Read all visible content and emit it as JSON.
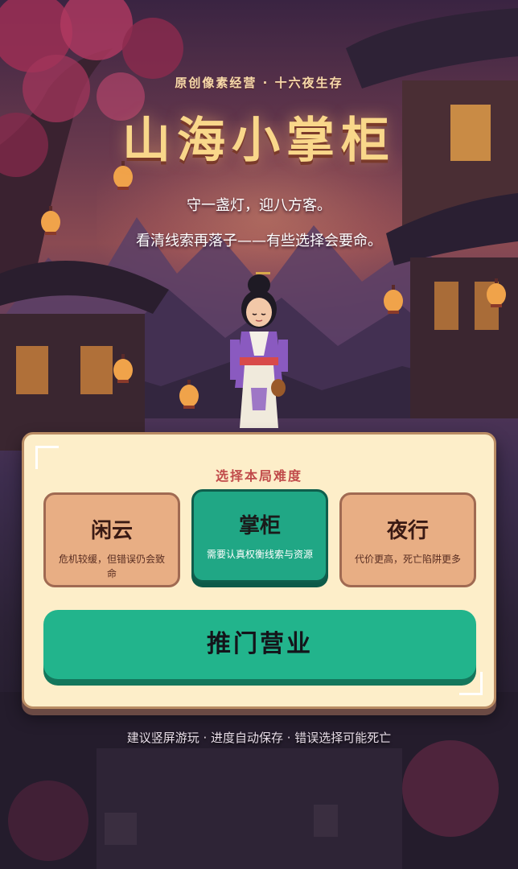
{
  "header": {
    "subtitle": "原创像素经营 · 十六夜生存",
    "title": "山海小掌柜",
    "tagline_line1": "守一盏灯，迎八方客。",
    "tagline_line2": "看清线索再落子——有些选择会要命。"
  },
  "difficulty_panel": {
    "heading": "选择本局难度",
    "selected": "掌柜",
    "options": [
      {
        "name": "闲云",
        "description": "危机较缓，但错误仍会致命"
      },
      {
        "name": "掌柜",
        "description": "需要认真权衡线索与资源"
      },
      {
        "name": "夜行",
        "description": "代价更高，死亡陷阱更多"
      }
    ],
    "start_label": "推门营业"
  },
  "footer": {
    "note": "建议竖屏游玩 · 进度自动保存 · 错误选择可能死亡"
  },
  "colors": {
    "accent_green": "#22b48c",
    "panel_bg": "#fdeec9",
    "card_bg": "#e8ae84",
    "heading_red": "#c04a4a",
    "title_gold": "#f9d78a"
  }
}
